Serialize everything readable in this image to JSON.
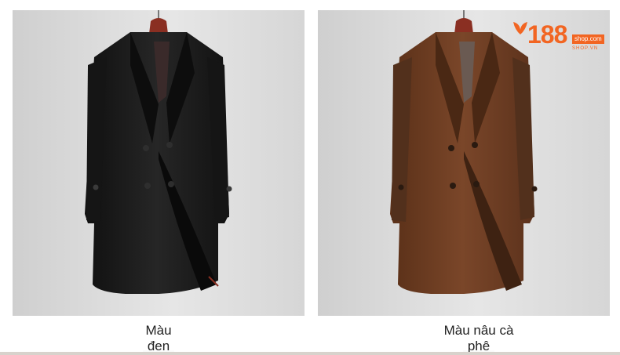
{
  "captions": {
    "left": {
      "line1": "Màu",
      "line2": "đen"
    },
    "right": {
      "line1": "Màu nâu cà",
      "line2": "phê"
    }
  },
  "logo": {
    "number": "188",
    "tag": "shop.com",
    "small": "SHOP.VN"
  },
  "colors": {
    "coat_black": "#1b1b1b",
    "coat_brown": "#6b3d24",
    "hanger": "#8a2f22",
    "logo_orange": "#f26522"
  }
}
